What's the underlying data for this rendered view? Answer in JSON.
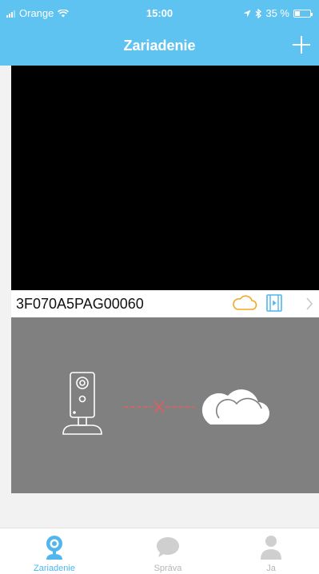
{
  "status_bar": {
    "carrier": "Orange",
    "time": "15:00",
    "battery": "35 %",
    "battery_level_percent": 35
  },
  "header": {
    "title": "Zariadenie",
    "add_icon": "plus-icon"
  },
  "device": {
    "serial": "3F070A5PAG00060",
    "icons": [
      "cloud-icon",
      "playback-icon",
      "chevron-right-icon"
    ]
  },
  "offline_illustration": {
    "icons": [
      "camera-icon",
      "disconnected-x-icon",
      "cloud-icon"
    ]
  },
  "tabs": [
    {
      "label": "Zariadenie",
      "icon": "camera-icon",
      "active": true
    },
    {
      "label": "Správa",
      "icon": "chat-bubble-icon",
      "active": false
    },
    {
      "label": "Ja",
      "icon": "person-icon",
      "active": false
    }
  ],
  "colors": {
    "accent": "#5ec3f0",
    "tab_active": "#4fb6ee",
    "tab_inactive": "#b5b5b5",
    "cloud_orange": "#f5a623",
    "offline_panel": "#808080"
  }
}
